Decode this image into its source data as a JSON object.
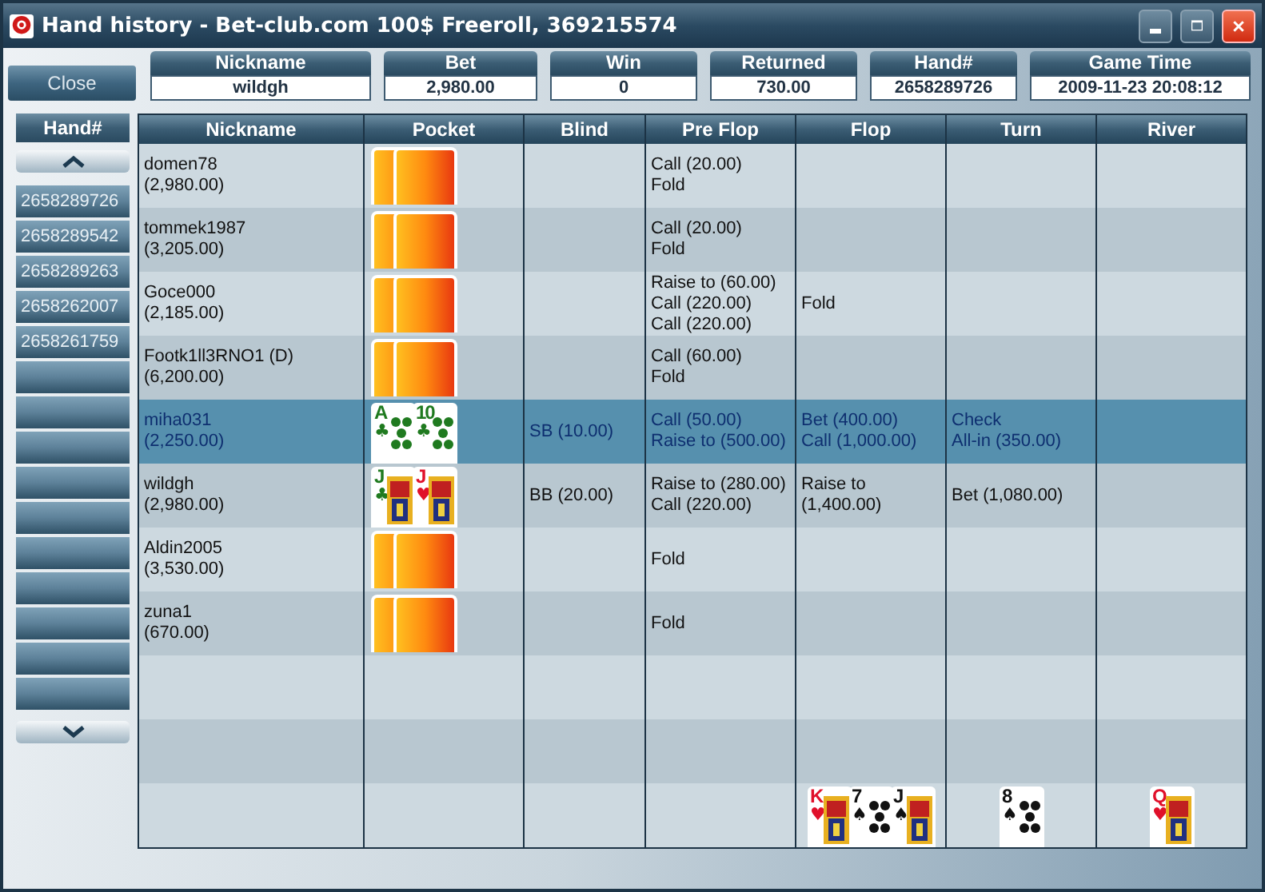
{
  "window": {
    "title": "Hand history - Bet-club.com 100$ Freeroll, 369215574"
  },
  "close_button": "Close",
  "summary": [
    {
      "label": "Nickname",
      "value": "wildgh"
    },
    {
      "label": "Bet",
      "value": "2,980.00"
    },
    {
      "label": "Win",
      "value": "0"
    },
    {
      "label": "Returned",
      "value": "730.00"
    },
    {
      "label": "Hand#",
      "value": "2658289726"
    },
    {
      "label": "Game Time",
      "value": "2009-11-23 20:08:12"
    }
  ],
  "hand_list": {
    "header": "Hand#",
    "items": [
      "2658289726",
      "2658289542",
      "2658289263",
      "2658262007",
      "2658261759"
    ]
  },
  "table": {
    "columns": [
      "Nickname",
      "Pocket",
      "Blind",
      "Pre Flop",
      "Flop",
      "Turn",
      "River"
    ],
    "rows": [
      {
        "name": "domen78",
        "stack": "(2,980.00)",
        "selected": false,
        "pocket": [
          {
            "kind": "back"
          },
          {
            "kind": "back"
          }
        ],
        "blind": "",
        "preflop": [
          "Call (20.00)",
          "Fold"
        ],
        "flop": [],
        "turn": [],
        "river": []
      },
      {
        "name": "tommek1987",
        "stack": "(3,205.00)",
        "selected": false,
        "pocket": [
          {
            "kind": "back"
          },
          {
            "kind": "back"
          }
        ],
        "blind": "",
        "preflop": [
          "Call (20.00)",
          "Fold"
        ],
        "flop": [],
        "turn": [],
        "river": []
      },
      {
        "name": "Goce000",
        "stack": "(2,185.00)",
        "selected": false,
        "pocket": [
          {
            "kind": "back"
          },
          {
            "kind": "back"
          }
        ],
        "blind": "",
        "preflop": [
          "Raise to (60.00)",
          "Call (220.00)",
          "Call (220.00)"
        ],
        "flop": [
          "Fold"
        ],
        "turn": [],
        "river": []
      },
      {
        "name": "Footk1ll3RNO1 (D)",
        "stack": "(6,200.00)",
        "selected": false,
        "pocket": [
          {
            "kind": "back"
          },
          {
            "kind": "back"
          }
        ],
        "blind": "",
        "preflop": [
          "Call (60.00)",
          "Fold"
        ],
        "flop": [],
        "turn": [],
        "river": []
      },
      {
        "name": "miha031",
        "stack": "(2,250.00)",
        "selected": true,
        "pocket": [
          {
            "kind": "pips",
            "rank": "A",
            "suit": "♣",
            "color": "#1f7a1f"
          },
          {
            "kind": "pips",
            "rank": "10",
            "suit": "♣",
            "color": "#1f7a1f"
          }
        ],
        "blind": "SB (10.00)",
        "preflop": [
          "Call (50.00)",
          "Raise to (500.00)"
        ],
        "flop": [
          "Bet (400.00)",
          "Call (1,000.00)"
        ],
        "turn": [
          "Check",
          "All-in (350.00)"
        ],
        "river": []
      },
      {
        "name": "wildgh",
        "stack": "(2,980.00)",
        "selected": false,
        "pocket": [
          {
            "kind": "court",
            "rank": "J",
            "suit": "♣",
            "color": "#1f7a1f"
          },
          {
            "kind": "court",
            "rank": "J",
            "suit": "♥",
            "color": "#e0102a"
          }
        ],
        "blind": "BB (20.00)",
        "preflop": [
          "Raise to (280.00)",
          "Call (220.00)"
        ],
        "flop": [
          "Raise to (1,400.00)"
        ],
        "turn": [
          "Bet (1,080.00)"
        ],
        "river": []
      },
      {
        "name": "Aldin2005",
        "stack": "(3,530.00)",
        "selected": false,
        "pocket": [
          {
            "kind": "back"
          },
          {
            "kind": "back"
          }
        ],
        "blind": "",
        "preflop": [
          "Fold"
        ],
        "flop": [],
        "turn": [],
        "river": []
      },
      {
        "name": "zuna1",
        "stack": "(670.00)",
        "selected": false,
        "pocket": [
          {
            "kind": "back"
          },
          {
            "kind": "back"
          }
        ],
        "blind": "",
        "preflop": [
          "Fold"
        ],
        "flop": [],
        "turn": [],
        "river": []
      }
    ],
    "board": {
      "flop": [
        {
          "kind": "court",
          "rank": "K",
          "suit": "♥",
          "color": "#e0102a"
        },
        {
          "kind": "pips",
          "rank": "7",
          "suit": "♠",
          "color": "#111111"
        },
        {
          "kind": "court",
          "rank": "J",
          "suit": "♠",
          "color": "#111111"
        }
      ],
      "turn": [
        {
          "kind": "pips",
          "rank": "8",
          "suit": "♠",
          "color": "#111111"
        }
      ],
      "river": [
        {
          "kind": "court",
          "rank": "Q",
          "suit": "♥",
          "color": "#e0102a"
        }
      ]
    }
  }
}
